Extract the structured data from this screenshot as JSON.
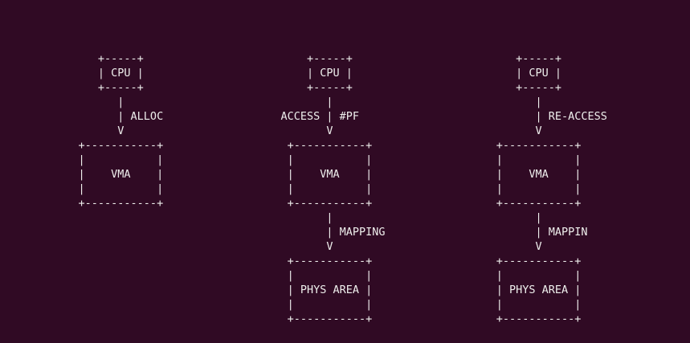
{
  "terminal": {
    "background": "#300a24",
    "foreground": "#eeeeec",
    "lines": [
      "",
      "               +-----+                         +-----+                         +-----+",
      "               | CPU |                         | CPU |                         | CPU |",
      "               +-----+                         +-----+                         +-----+",
      "                  |                               |                               |",
      "                  | ALLOC                  ACCESS | #PF                           | RE-ACCESS",
      "                  V                               V                               V",
      "            +-----------+                   +-----------+                   +-----------+",
      "            |           |                   |           |                   |           |",
      "            |    VMA    |                   |    VMA    |                   |    VMA    |",
      "            |           |                   |           |                   |           |",
      "            +-----------+                   +-----------+                   +-----------+",
      "                                                  |                               |",
      "                                                  | MAPPING                       | MAPPIN",
      "                                                  V                               V",
      "                                            +-----------+                   +-----------+",
      "                                            |           |                   |           |",
      "                                            | PHYS AREA |                   | PHYS AREA |",
      "                                            |           |                   |           |",
      "                                            +-----------+                   +-----------+"
    ]
  }
}
